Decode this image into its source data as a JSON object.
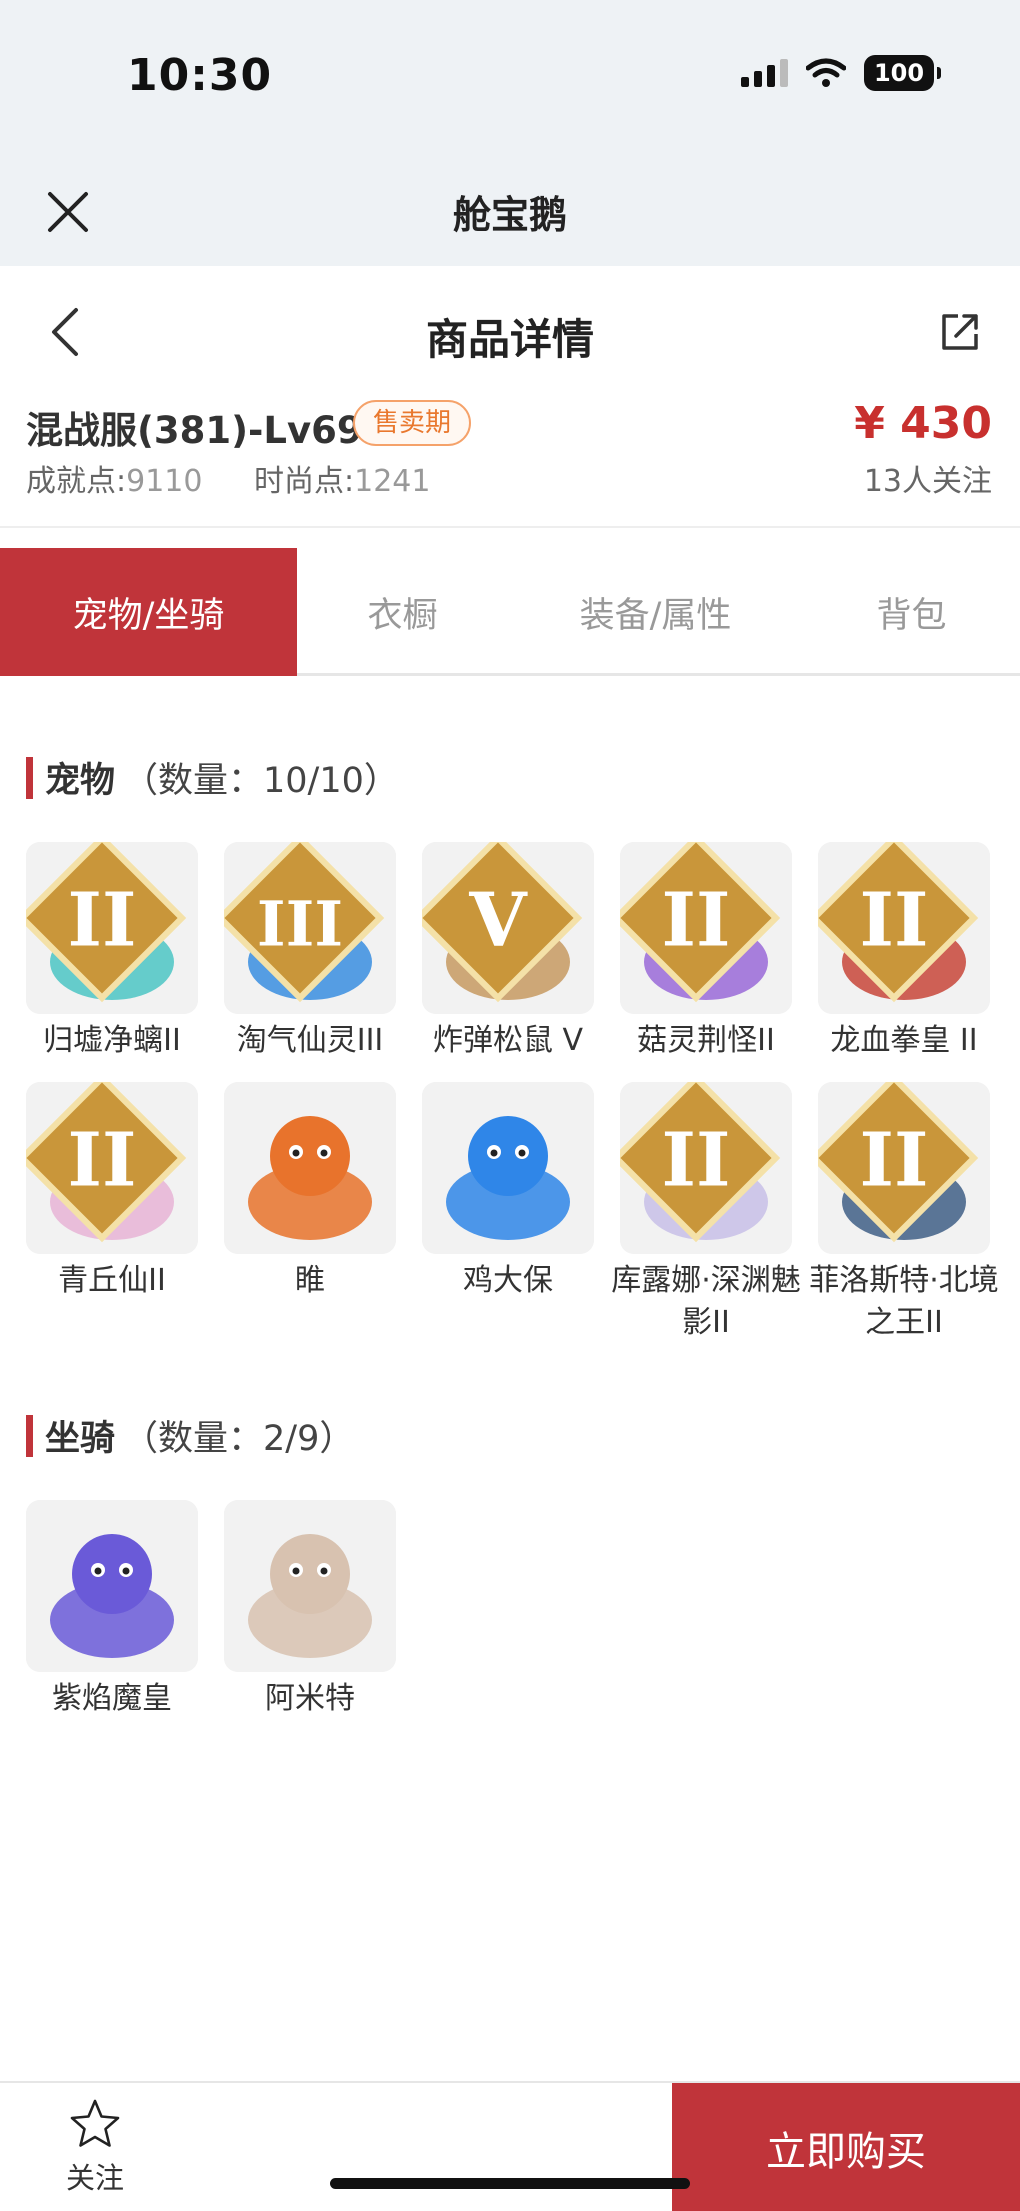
{
  "status_bar": {
    "time": "10:30",
    "battery": "100"
  },
  "miniapp": {
    "title": "舱宝鹅"
  },
  "header": {
    "title": "商品详情"
  },
  "product": {
    "name": "混战服(381)-Lv69",
    "status": "售卖期",
    "price": "¥ 430",
    "achievement_label": "成就点:",
    "achievement_value": "9110",
    "fashion_label": "时尚点:",
    "fashion_value": "1241",
    "followers": "13人关注"
  },
  "tabs": [
    {
      "label": "宠物/坐骑",
      "active": true
    },
    {
      "label": "衣橱",
      "active": false
    },
    {
      "label": "装备/属性",
      "active": false
    },
    {
      "label": "背包",
      "active": false
    }
  ],
  "pets": {
    "title": "宠物",
    "count": "（数量：10/10）",
    "items": [
      {
        "name": "归墟净螭II",
        "rank": "II",
        "color": "#4cc6c4"
      },
      {
        "name": "淘气仙灵III",
        "rank": "III",
        "color": "#3a8ee0"
      },
      {
        "name": "炸弹松鼠 V",
        "rank": "V",
        "color": "#c79a62"
      },
      {
        "name": "菇灵荆怪II",
        "rank": "II",
        "color": "#9a6ad8"
      },
      {
        "name": "龙血拳皇 II",
        "rank": "II",
        "color": "#c8473a"
      },
      {
        "name": "青丘仙II",
        "rank": "II",
        "color": "#e8b4d6"
      },
      {
        "name": "睢",
        "rank": "",
        "color": "#e8732c"
      },
      {
        "name": "鸡大保",
        "rank": "",
        "color": "#2f86e8"
      },
      {
        "name": "库露娜·深渊魅影II",
        "rank": "II",
        "color": "#c8c0e8"
      },
      {
        "name": "菲洛斯特·北境之王II",
        "rank": "II",
        "color": "#3f5f86"
      }
    ]
  },
  "mounts": {
    "title": "坐骑",
    "count": "（数量：2/9）",
    "items": [
      {
        "name": "紫焰魔皇",
        "rank": "",
        "color": "#6a5ad8"
      },
      {
        "name": "阿米特",
        "rank": "",
        "color": "#d8c2b0"
      }
    ]
  },
  "bottom": {
    "follow_label": "关注",
    "buy_label": "立即购买"
  },
  "colors": {
    "accent": "#c0343a",
    "badge": "#e9782e",
    "price": "#c8302e"
  }
}
